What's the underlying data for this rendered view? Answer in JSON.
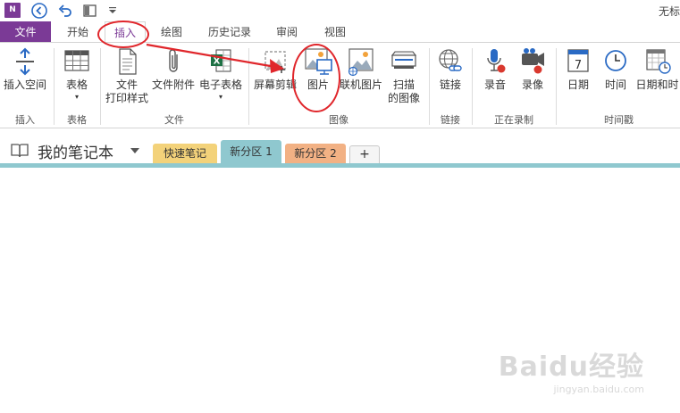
{
  "window": {
    "title": "无标"
  },
  "tabs": [
    {
      "label": "文件"
    },
    {
      "label": "开始"
    },
    {
      "label": "插入"
    },
    {
      "label": "绘图"
    },
    {
      "label": "历史记录"
    },
    {
      "label": "审阅"
    },
    {
      "label": "视图"
    }
  ],
  "ribbon": {
    "insert_space": "插入空间",
    "table": "表格",
    "file_printout_1": "文件",
    "file_printout_2": "打印样式",
    "file_attachment": "文件附件",
    "spreadsheet": "电子表格",
    "screen_clipping": "屏幕剪辑",
    "picture": "图片",
    "online_picture": "联机图片",
    "scan_1": "扫描",
    "scan_2": "的图像",
    "link": "链接",
    "record_audio": "录音",
    "record_video": "录像",
    "date": "日期",
    "time": "时间",
    "date_time": "日期和时",
    "groups": {
      "insert": "插入",
      "tables": "表格",
      "files": "文件",
      "images": "图像",
      "links": "链接",
      "recording": "正在录制",
      "timestamp": "时间戳"
    }
  },
  "notebook": {
    "name": "我的笔记本",
    "sections": [
      "快速笔记",
      "新分区 1",
      "新分区 2"
    ],
    "add": "+"
  },
  "watermark": {
    "brand": "Baidu经验",
    "url": "jingyan.baidu.com"
  },
  "colors": {
    "accent": "#7b3a96",
    "annotation": "#e0262b",
    "section_line": "#8fc8cf"
  }
}
